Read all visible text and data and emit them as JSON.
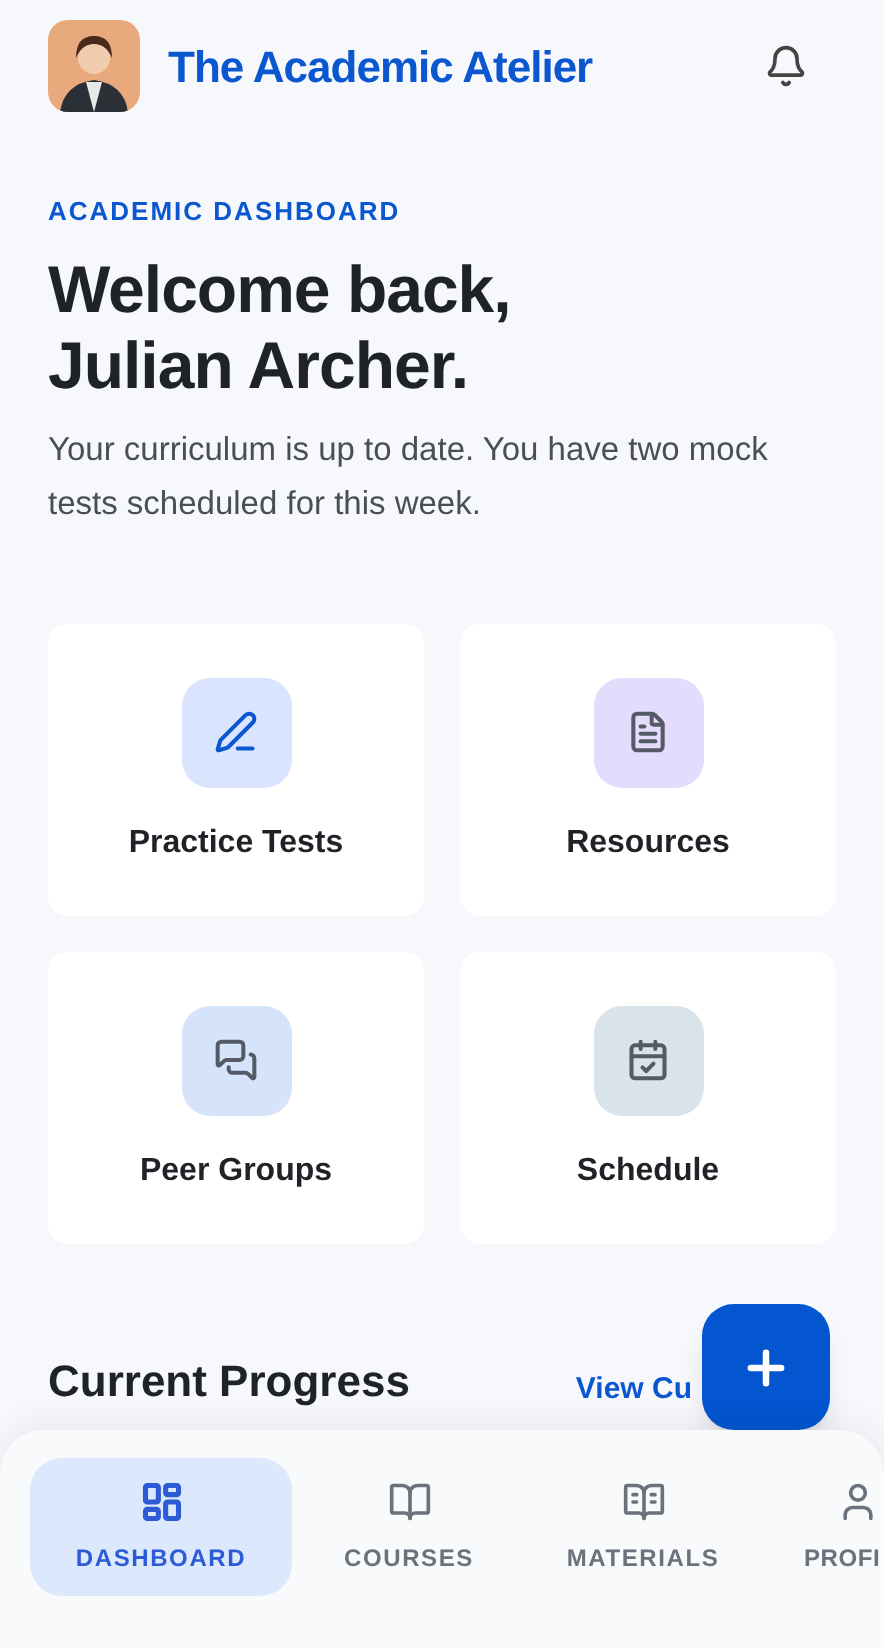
{
  "header": {
    "title": "The Academic Atelier"
  },
  "eyebrow": "ACADEMIC DASHBOARD",
  "greeting": {
    "line_1": "Welcome back,",
    "line_2": "Julian Archer."
  },
  "summary": "Your curriculum is up to date. You have two mock tests scheduled for this week.",
  "tiles": [
    {
      "label": "Practice Tests",
      "kind": "test",
      "color": "#dbe4ff"
    },
    {
      "label": "Resources",
      "kind": "doc",
      "color": "#e4dcfc"
    },
    {
      "label": "Peer Groups",
      "kind": "chat",
      "color": "#d6e4fb"
    },
    {
      "label": "Schedule",
      "kind": "calendar",
      "color": "#d9e3ea"
    }
  ],
  "progress": {
    "title": "Current Progress",
    "link": "View Cu"
  },
  "nav": [
    {
      "label": "DASHBOARD",
      "kind": "grid",
      "selected": true
    },
    {
      "label": "COURSES",
      "kind": "book",
      "selected": false
    },
    {
      "label": "MATERIALS",
      "kind": "reader",
      "selected": false
    },
    {
      "label": "PROFI",
      "kind": "person",
      "selected": false
    }
  ]
}
